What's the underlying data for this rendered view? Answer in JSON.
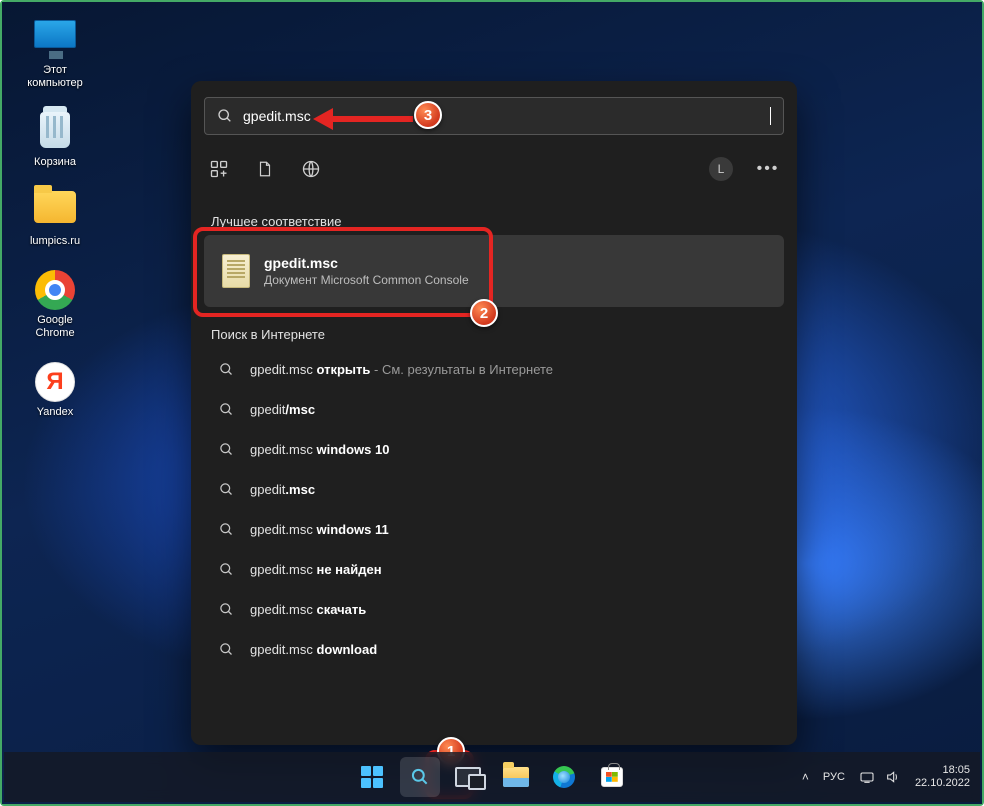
{
  "desktop": {
    "icons": [
      {
        "label": "Этот\nкомпьютер"
      },
      {
        "label": "Корзина"
      },
      {
        "label": "lumpics.ru"
      },
      {
        "label": "Google\nChrome"
      },
      {
        "label": "Yandex"
      }
    ]
  },
  "search": {
    "query": "gpedit.msc",
    "best_match_header": "Лучшее соответствие",
    "best_match": {
      "title": "gpedit.msc",
      "subtitle": "Документ Microsoft Common Console"
    },
    "web_header": "Поиск в Интернете",
    "avatar_letter": "L",
    "suggestions": [
      {
        "pre": "gpedit.msc ",
        "bold": "открыть",
        "ext": " - См. результаты в Интернете"
      },
      {
        "pre": "gpedit",
        "bold": "/msc",
        "ext": ""
      },
      {
        "pre": "gpedit.msc ",
        "bold": "windows 10",
        "ext": ""
      },
      {
        "pre": "gpedit",
        "bold": ".msc",
        "ext": ""
      },
      {
        "pre": "gpedit.msc ",
        "bold": "windows 11",
        "ext": ""
      },
      {
        "pre": "gpedit.msc ",
        "bold": "не найден",
        "ext": ""
      },
      {
        "pre": "gpedit.msc ",
        "bold": "скачать",
        "ext": ""
      },
      {
        "pre": "gpedit.msc ",
        "bold": "download",
        "ext": ""
      }
    ]
  },
  "taskbar": {
    "language": "РУС",
    "time": "18:05",
    "date": "22.10.2022"
  },
  "annotations": {
    "b1": "1",
    "b2": "2",
    "b3": "3"
  }
}
